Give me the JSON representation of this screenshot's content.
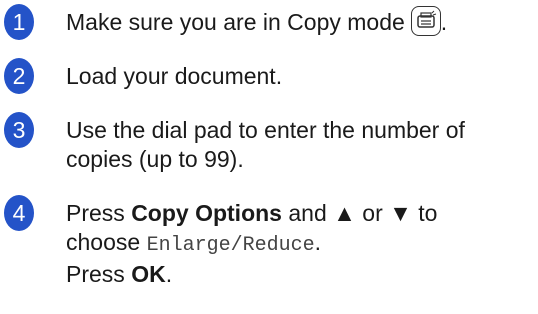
{
  "colors": {
    "badge": "#2453c8",
    "text": "#1a1a1a"
  },
  "steps": [
    {
      "number": "1",
      "text": "Make sure you are in Copy mode",
      "icon": "copy-mode-icon",
      "after_icon": "."
    },
    {
      "number": "2",
      "text": "Load your document."
    },
    {
      "number": "3",
      "line1": "Use the dial pad to enter the number of",
      "line2": "copies (up to 99)."
    },
    {
      "number": "4",
      "press": "Press",
      "copy_options": "Copy Options",
      "and_text": "and ▲ or ▼ to",
      "choose": "choose",
      "enlarge_reduce": "Enlarge/Reduce",
      "period": ".",
      "press2": "Press",
      "ok": "OK",
      "period2": "."
    }
  ]
}
